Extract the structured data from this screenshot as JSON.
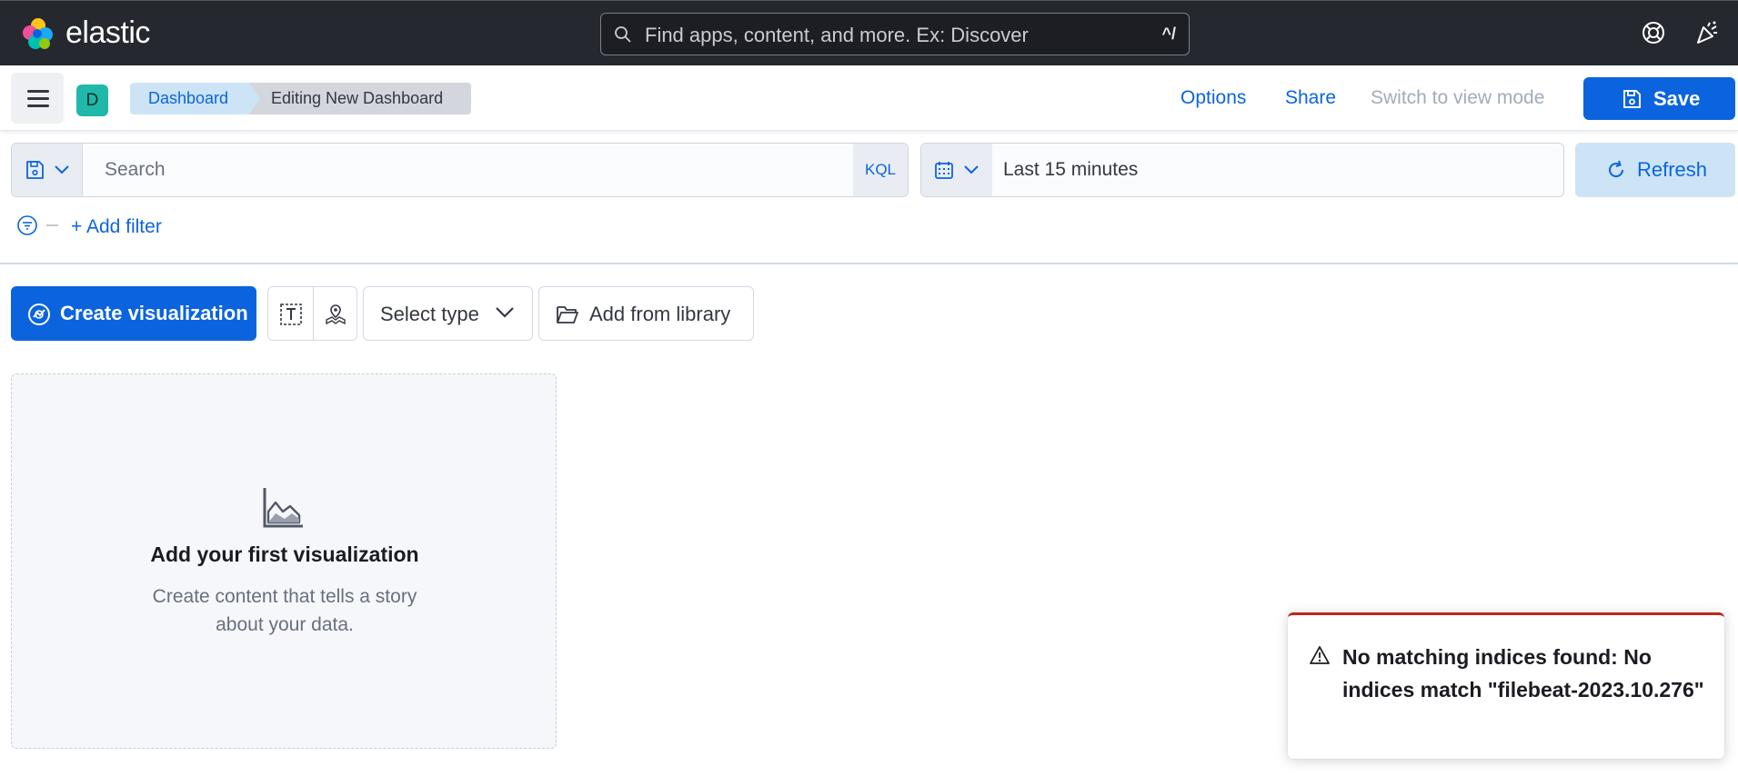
{
  "header": {
    "logo_text": "elastic",
    "global_search_placeholder": "Find apps, content, and more. Ex: Discover",
    "global_search_shortcut": "^/",
    "help_icon": "help-icon",
    "news_icon": "newsfeed-icon"
  },
  "subheader": {
    "space_initial": "D",
    "breadcrumbs": [
      "Dashboard",
      "Editing New Dashboard"
    ],
    "options_label": "Options",
    "share_label": "Share",
    "switch_mode_label": "Switch to view mode",
    "save_label": "Save"
  },
  "query_bar": {
    "search_placeholder": "Search",
    "language_label": "KQL",
    "time_range": "Last 15 minutes",
    "refresh_label": "Refresh"
  },
  "filters": {
    "add_filter_label": "+ Add filter"
  },
  "toolbar": {
    "create_label": "Create visualization",
    "select_type_label": "Select type",
    "add_library_label": "Add from library"
  },
  "empty_state": {
    "title": "Add your first visualization",
    "description": "Create content that tells a story about your data."
  },
  "toast": {
    "message": "No matching indices found: No indices match \"filebeat-2023.10.276\""
  },
  "colors": {
    "header_bg": "#25282f",
    "primary": "#0b64dd",
    "danger": "#bd271e",
    "space_avatar": "#20b8a8"
  }
}
